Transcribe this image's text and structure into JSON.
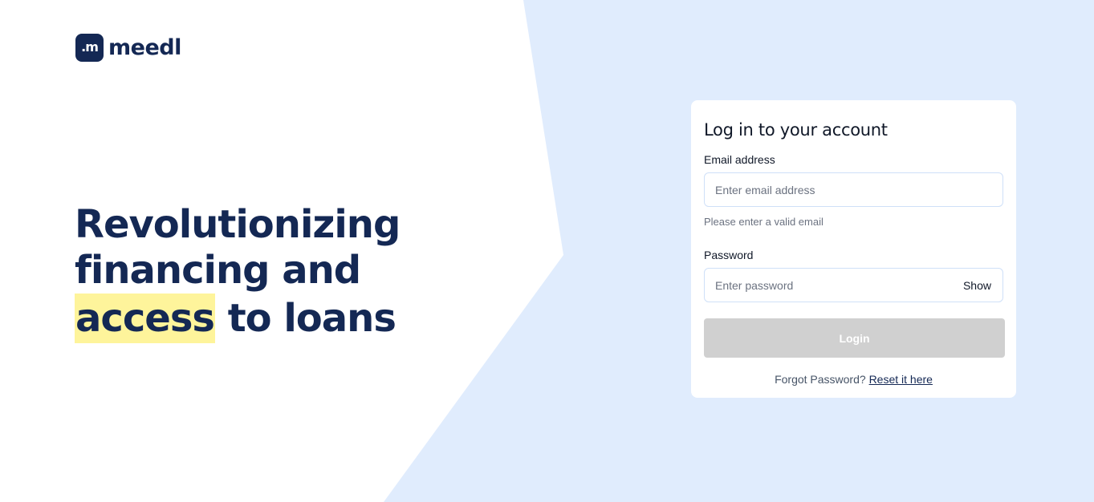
{
  "brand": {
    "logo_mark": ".m",
    "name": "meedl"
  },
  "hero": {
    "line1": "Revolutionizing",
    "line2": "financing and",
    "line3_highlight": "access",
    "line3_rest": " to loans"
  },
  "login_form": {
    "title": "Log in to your account",
    "email_label": "Email address",
    "email_placeholder": "Enter email address",
    "email_value": "",
    "email_hint": "Please enter a valid email",
    "password_label": "Password",
    "password_placeholder": "Enter password",
    "password_value": "",
    "show_label": "Show",
    "login_label": "Login",
    "forgot_text": "Forgot Password?",
    "reset_link": "Reset it here"
  },
  "colors": {
    "brand_navy": "#142854",
    "highlight_yellow": "#fef49b",
    "background_blue": "#e0ecfd",
    "disabled_button": "#d0d0d0"
  }
}
